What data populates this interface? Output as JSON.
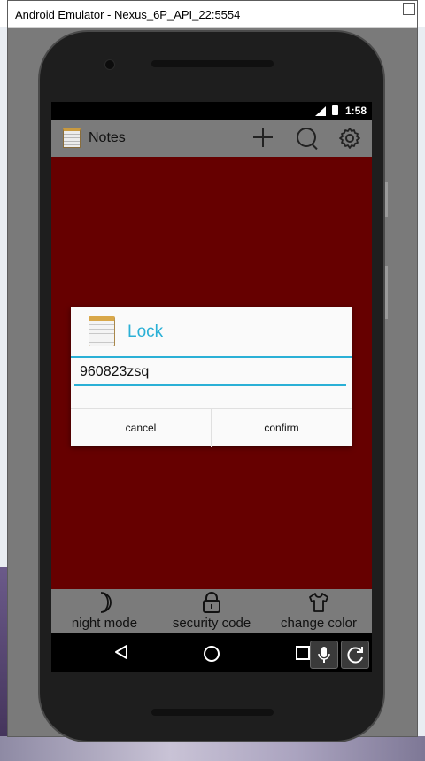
{
  "window": {
    "title": "Android Emulator - Nexus_6P_API_22:5554"
  },
  "status_bar": {
    "time": "1:58"
  },
  "app_bar": {
    "title": "Notes",
    "icons": [
      "notes-app-icon",
      "add-icon",
      "search-icon",
      "gear-icon"
    ]
  },
  "dialog": {
    "title": "Lock",
    "input_value": "960823zsq",
    "cancel_label": "cancel",
    "confirm_label": "confirm",
    "accent_color": "#2ab0d6"
  },
  "toolbar": {
    "night_mode_label": "night mode",
    "security_code_label": "security code",
    "change_color_label": "change color"
  },
  "colors": {
    "background": "#660000",
    "bars": "#7b7b7b"
  }
}
